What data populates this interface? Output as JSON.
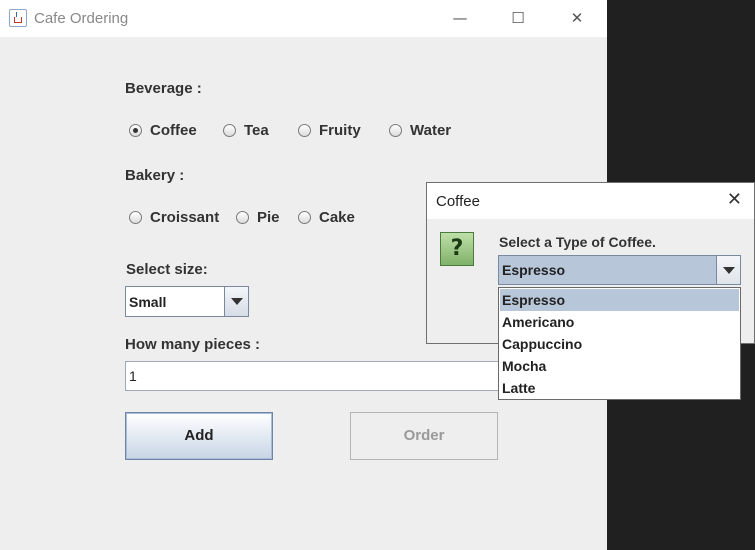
{
  "window": {
    "title": "Cafe Ordering",
    "controls": {
      "minimize": "—",
      "maximize": "☐",
      "close": "✕"
    }
  },
  "form": {
    "beverage_label": "Beverage :",
    "beverages": [
      {
        "label": "Coffee",
        "selected": true
      },
      {
        "label": "Tea",
        "selected": false
      },
      {
        "label": "Fruity",
        "selected": false
      },
      {
        "label": "Water",
        "selected": false
      }
    ],
    "bakery_label": "Bakery :",
    "bakery": [
      {
        "label": "Croissant",
        "selected": false
      },
      {
        "label": "Pie",
        "selected": false
      },
      {
        "label": "Cake",
        "selected": false
      }
    ],
    "size_label": "Select size:",
    "size_value": "Small",
    "pieces_label": "How many pieces :",
    "pieces_value": "1",
    "add_label": "Add",
    "order_label": "Order"
  },
  "dialog": {
    "title": "Coffee",
    "close": "✕",
    "icon": "question-icon",
    "icon_glyph": "?",
    "prompt": "Select a Type of Coffee.",
    "selected_value": "Espresso",
    "options": [
      "Espresso",
      "Americano",
      "Cappuccino",
      "Mocha",
      "Latte"
    ],
    "selected_index": 0
  },
  "colors": {
    "selection": "#b8c6da",
    "window_bg": "#eeeeee",
    "desktop_bg": "#202020",
    "icon_green": "#7fb26a"
  }
}
